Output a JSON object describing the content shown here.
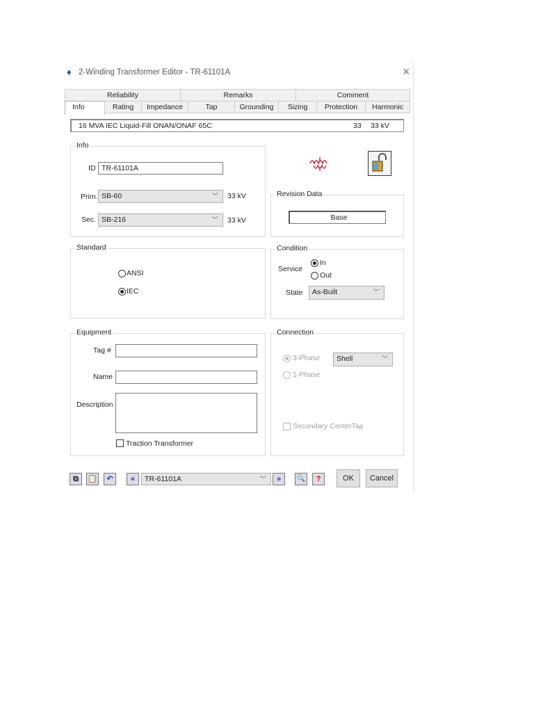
{
  "window": {
    "title": "2-Winding Transformer Editor - TR-61101A",
    "close": "×"
  },
  "tabs_row1": [
    "Reliability",
    "Remarks",
    "Comment"
  ],
  "tabs_row2": [
    "Info",
    "Rating",
    "Impedance",
    "Tap",
    "Grounding",
    "Sizing",
    "Protection",
    "Harmonic"
  ],
  "summary": {
    "text": "16 MVA  IEC  Liquid-Fill  ONAN/ONAF  65C",
    "num": "33",
    "kv": "33 kV"
  },
  "info": {
    "legend": "Info",
    "id_label": "ID",
    "id_value": "TR-61101A",
    "prim_label": "Prim.",
    "prim_value": "SB-60",
    "prim_kv": "33 kV",
    "sec_label": "Sec.",
    "sec_value": "SB-216",
    "sec_kv": "33 kV"
  },
  "revision": {
    "legend": "Revision Data",
    "value": "Base"
  },
  "standard": {
    "legend": "Standard",
    "options": [
      "ANSI",
      "IEC"
    ],
    "selected": "IEC"
  },
  "condition": {
    "legend": "Condition",
    "service_label": "Service",
    "service_options": [
      "In",
      "Out"
    ],
    "service_selected": "In",
    "state_label": "State",
    "state_value": "As-Built"
  },
  "equipment": {
    "legend": "Equipment",
    "tag_label": "Tag #",
    "tag_value": "",
    "name_label": "Name",
    "name_value": "",
    "desc_label": "Description",
    "desc_value": "",
    "traction_label": "Traction Transformer"
  },
  "connection": {
    "legend": "Connection",
    "phase3": "3-Phase",
    "phase1": "1-Phase",
    "type_value": "Shell",
    "centertap": "Secondary CenterTap"
  },
  "bottom": {
    "nav_value": "TR-61101A",
    "ok": "OK",
    "cancel": "Cancel"
  }
}
